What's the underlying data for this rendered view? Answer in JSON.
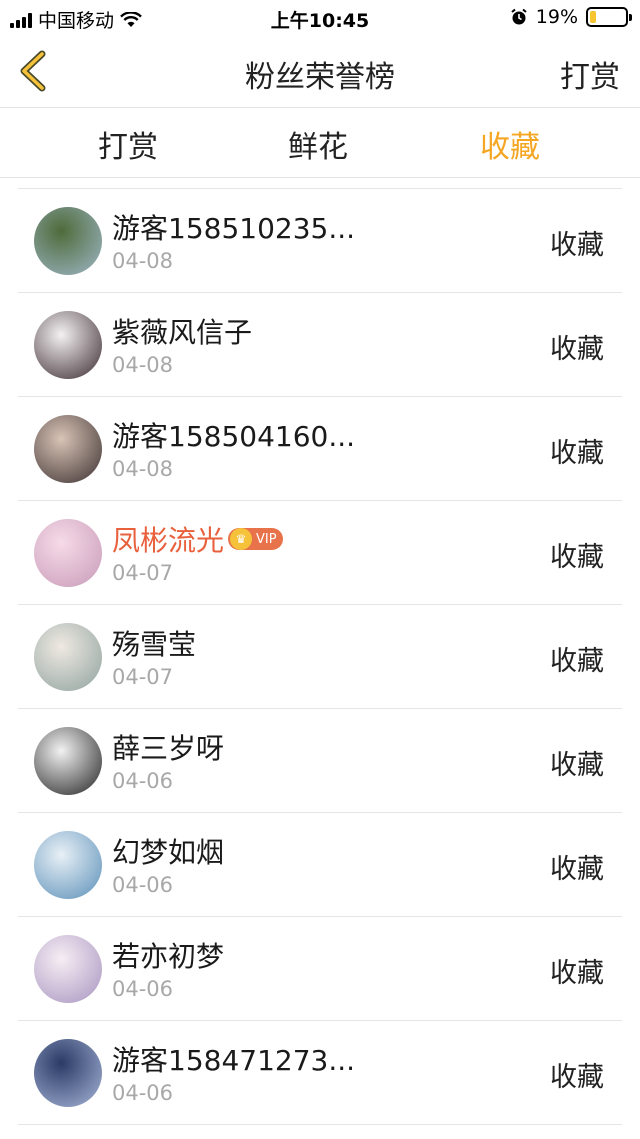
{
  "status_bar": {
    "carrier": "中国移动",
    "time": "上午10:45",
    "battery": "19%",
    "battery_level": 0.19
  },
  "nav": {
    "title": "粉丝荣誉榜",
    "action": "打赏"
  },
  "tabs": [
    {
      "label": "打赏",
      "active": false
    },
    {
      "label": "鲜花",
      "active": false
    },
    {
      "label": "收藏",
      "active": true
    }
  ],
  "colors": {
    "accent": "#f5a623",
    "vip": "#e8603c"
  },
  "list": [
    {
      "name": "游客158510235...",
      "date": "04-08",
      "action": "收藏",
      "vip": false,
      "avatar_bg": "#4e6b3a,#9fb7c8"
    },
    {
      "name": "紫薇风信子",
      "date": "04-08",
      "action": "收藏",
      "vip": false,
      "avatar_bg": "#f4f1f2,#3a2a30"
    },
    {
      "name": "游客158504160...",
      "date": "04-08",
      "action": "收藏",
      "vip": false,
      "avatar_bg": "#d9c4b6,#3b3030"
    },
    {
      "name": "凤彬流光",
      "date": "04-07",
      "action": "收藏",
      "vip": true,
      "vip_label": "VIP",
      "avatar_bg": "#f6dbe8,#c89ab8"
    },
    {
      "name": "殇雪莹",
      "date": "04-07",
      "action": "收藏",
      "vip": false,
      "avatar_bg": "#efe9e2,#8fa29e"
    },
    {
      "name": "薛三岁呀",
      "date": "04-06",
      "action": "收藏",
      "vip": false,
      "avatar_bg": "#f2f2f2,#222222"
    },
    {
      "name": "幻梦如烟",
      "date": "04-06",
      "action": "收藏",
      "vip": false,
      "avatar_bg": "#e8f0f6,#5a8fb8"
    },
    {
      "name": "若亦初梦",
      "date": "04-06",
      "action": "收藏",
      "vip": false,
      "avatar_bg": "#f6eef4,#a894c0"
    },
    {
      "name": "游客158471273...",
      "date": "04-06",
      "action": "收藏",
      "vip": false,
      "avatar_bg": "#2a3a66,#a8b6d8"
    }
  ]
}
